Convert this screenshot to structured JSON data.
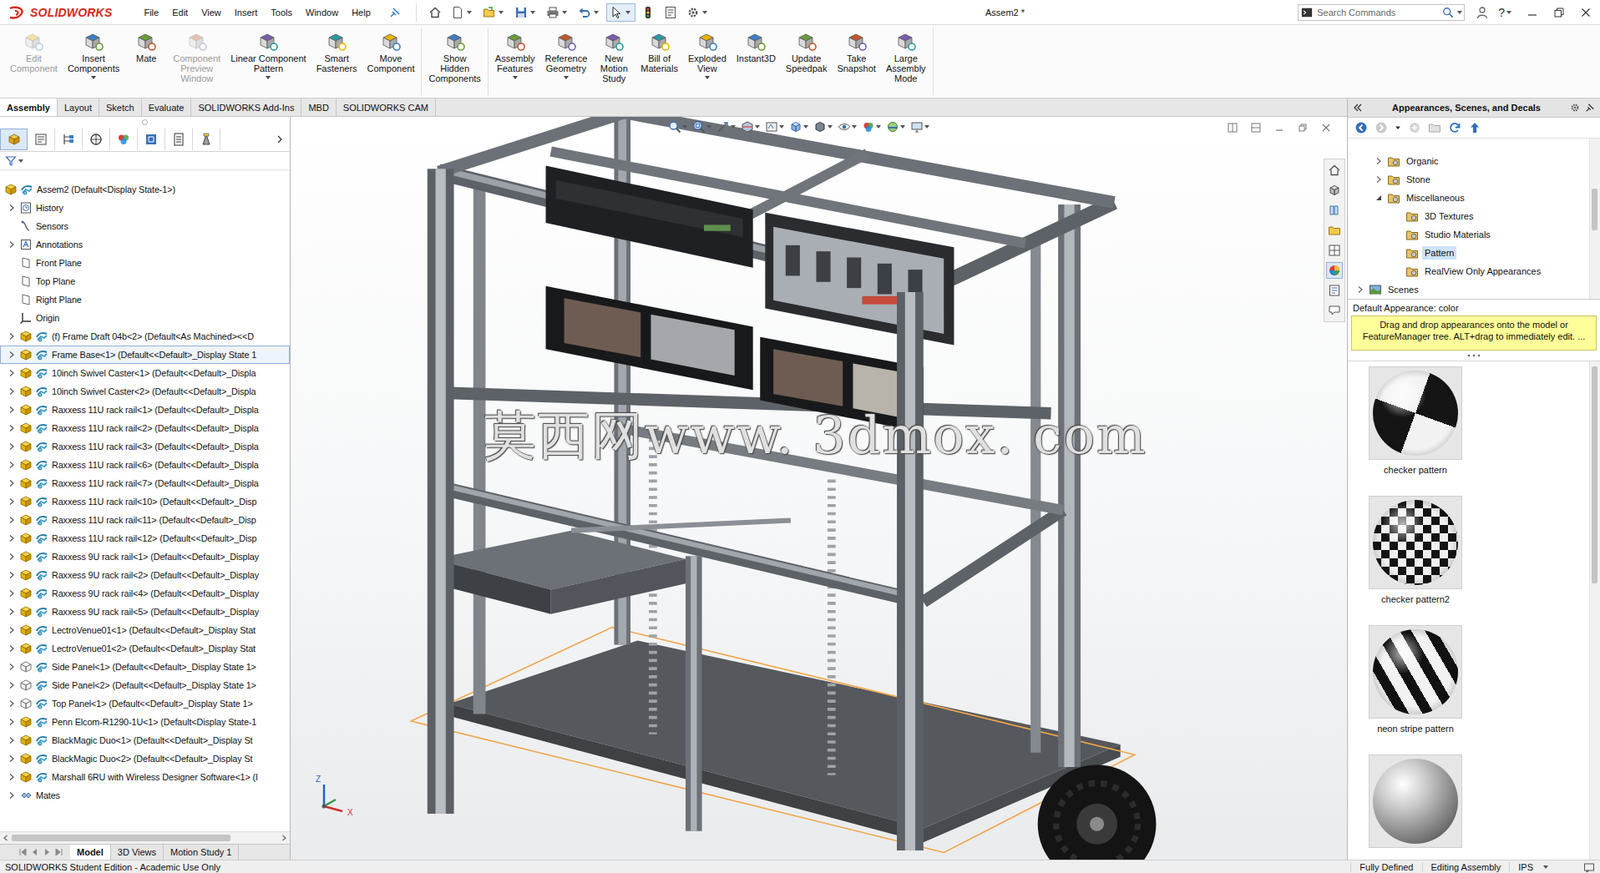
{
  "app": {
    "logo": "SOLIDWORKS",
    "title": "Assem2 *"
  },
  "menu": [
    "File",
    "Edit",
    "View",
    "Insert",
    "Tools",
    "Window",
    "Help"
  ],
  "toolbar": [
    {
      "selected": false
    },
    {
      "selected": false
    },
    {
      "selected": false
    },
    {
      "selected": false
    },
    {
      "selected": false
    },
    {
      "selected": false
    },
    {
      "selected": true
    },
    {
      "selected": false
    },
    {
      "selected": false
    },
    {
      "selected": false
    }
  ],
  "search": {
    "placeholder": "Search Commands"
  },
  "help": "?",
  "ribbon": {
    "groups": [
      [
        {
          "lines": [
            "Edit",
            "Component"
          ],
          "disabled": true,
          "dropdown": false
        },
        {
          "lines": [
            "Insert",
            "Components"
          ],
          "disabled": false,
          "dropdown": true
        },
        {
          "lines": [
            "Mate"
          ],
          "disabled": false,
          "dropdown": false
        },
        {
          "lines": [
            "Component",
            "Preview",
            "Window"
          ],
          "disabled": true,
          "dropdown": false
        },
        {
          "lines": [
            "Linear Component",
            "Pattern"
          ],
          "disabled": false,
          "dropdown": true
        },
        {
          "lines": [
            "Smart",
            "Fasteners"
          ],
          "disabled": false,
          "dropdown": false
        },
        {
          "lines": [
            "Move",
            "Component"
          ],
          "disabled": false,
          "dropdown": false
        }
      ],
      [
        {
          "lines": [
            "Show",
            "Hidden",
            "Components"
          ],
          "disabled": false,
          "dropdown": false
        }
      ],
      [
        {
          "lines": [
            "Assembly",
            "Features"
          ],
          "disabled": false,
          "dropdown": true
        },
        {
          "lines": [
            "Reference",
            "Geometry"
          ],
          "disabled": false,
          "dropdown": true
        },
        {
          "lines": [
            "New",
            "Motion",
            "Study"
          ],
          "disabled": false,
          "dropdown": false
        },
        {
          "lines": [
            "Bill of",
            "Materials"
          ],
          "disabled": false,
          "dropdown": false
        },
        {
          "lines": [
            "Exploded",
            "View"
          ],
          "disabled": false,
          "dropdown": true
        },
        {
          "lines": [
            "Instant3D"
          ],
          "disabled": false,
          "dropdown": false
        },
        {
          "lines": [
            "Update",
            "Speedpak"
          ],
          "disabled": false,
          "dropdown": false
        },
        {
          "lines": [
            "Take",
            "Snapshot"
          ],
          "disabled": false,
          "dropdown": false
        },
        {
          "lines": [
            "Large",
            "Assembly",
            "Mode"
          ],
          "disabled": false,
          "dropdown": false
        }
      ]
    ]
  },
  "command_tabs": [
    {
      "label": "Assembly",
      "selected": true
    },
    {
      "label": "Layout",
      "selected": false
    },
    {
      "label": "Sketch",
      "selected": false
    },
    {
      "label": "Evaluate",
      "selected": false
    },
    {
      "label": "SOLIDWORKS Add-Ins",
      "selected": false
    },
    {
      "label": "MBD",
      "selected": false
    },
    {
      "label": "SOLIDWORKS CAM",
      "selected": false
    }
  ],
  "feature_manager": {
    "tabs": [
      {
        "selected": true
      },
      {
        "selected": false
      },
      {
        "selected": false
      },
      {
        "selected": false
      },
      {
        "selected": false
      },
      {
        "selected": false
      },
      {
        "selected": false
      },
      {
        "selected": false
      }
    ],
    "tree": [
      {
        "label": "Assem2 (Default<Display State-1>)",
        "kind": "root",
        "depth": 0,
        "arrow": false,
        "selected": false
      },
      {
        "label": "History",
        "kind": "history",
        "depth": 1,
        "arrow": true,
        "selected": false
      },
      {
        "label": "Sensors",
        "kind": "sensors",
        "depth": 1,
        "arrow": false,
        "selected": false
      },
      {
        "label": "Annotations",
        "kind": "annotations",
        "depth": 1,
        "arrow": true,
        "selected": false
      },
      {
        "label": "Front Plane",
        "kind": "plane",
        "depth": 1,
        "arrow": false,
        "selected": false
      },
      {
        "label": "Top Plane",
        "kind": "plane",
        "depth": 1,
        "arrow": false,
        "selected": false
      },
      {
        "label": "Right Plane",
        "kind": "plane",
        "depth": 1,
        "arrow": false,
        "selected": false
      },
      {
        "label": "Origin",
        "kind": "origin",
        "depth": 1,
        "arrow": false,
        "selected": false
      },
      {
        "label": "(f) Frame Draft 04b<2> (Default<As Machined><<D",
        "kind": "assembly",
        "depth": 1,
        "arrow": true,
        "selected": false
      },
      {
        "label": "Frame Base<1> (Default<<Default>_Display State 1",
        "kind": "assembly",
        "depth": 1,
        "arrow": true,
        "selected": true
      },
      {
        "label": "10inch Swivel Caster<1> (Default<<Default>_Displa",
        "kind": "assembly",
        "depth": 1,
        "arrow": true,
        "selected": false
      },
      {
        "label": "10inch Swivel Caster<2> (Default<<Default>_Displa",
        "kind": "assembly",
        "depth": 1,
        "arrow": true,
        "selected": false
      },
      {
        "label": "Raxxess 11U rack rail<1> (Default<<Default>_Displa",
        "kind": "assembly",
        "depth": 1,
        "arrow": true,
        "selected": false
      },
      {
        "label": "Raxxess 11U rack rail<2> (Default<<Default>_Displa",
        "kind": "assembly",
        "depth": 1,
        "arrow": true,
        "selected": false
      },
      {
        "label": "Raxxess 11U rack rail<3> (Default<<Default>_Displa",
        "kind": "assembly",
        "depth": 1,
        "arrow": true,
        "selected": false
      },
      {
        "label": "Raxxess 11U rack rail<6> (Default<<Default>_Displa",
        "kind": "assembly",
        "depth": 1,
        "arrow": true,
        "selected": false
      },
      {
        "label": "Raxxess 11U rack rail<7> (Default<<Default>_Displa",
        "kind": "assembly",
        "depth": 1,
        "arrow": true,
        "selected": false
      },
      {
        "label": "Raxxess 11U rack rail<10> (Default<<Default>_Disp",
        "kind": "assembly",
        "depth": 1,
        "arrow": true,
        "selected": false
      },
      {
        "label": "Raxxess 11U rack rail<11> (Default<<Default>_Disp",
        "kind": "assembly",
        "depth": 1,
        "arrow": true,
        "selected": false
      },
      {
        "label": "Raxxess 11U rack rail<12> (Default<<Default>_Disp",
        "kind": "assembly",
        "depth": 1,
        "arrow": true,
        "selected": false
      },
      {
        "label": "Raxxess 9U rack rail<1> (Default<<Default>_Display",
        "kind": "assembly",
        "depth": 1,
        "arrow": true,
        "selected": false
      },
      {
        "label": "Raxxess 9U rack rail<2> (Default<<Default>_Display",
        "kind": "assembly",
        "depth": 1,
        "arrow": true,
        "selected": false
      },
      {
        "label": "Raxxess 9U rack rail<4> (Default<<Default>_Display",
        "kind": "assembly",
        "depth": 1,
        "arrow": true,
        "selected": false
      },
      {
        "label": "Raxxess 9U rack rail<5> (Default<<Default>_Display",
        "kind": "assembly",
        "depth": 1,
        "arrow": true,
        "selected": false
      },
      {
        "label": "LectroVenue01<1> (Default<<Default>_Display Stat",
        "kind": "assembly",
        "depth": 1,
        "arrow": true,
        "selected": false
      },
      {
        "label": "LectroVenue01<2> (Default<<Default>_Display Stat",
        "kind": "assembly",
        "depth": 1,
        "arrow": true,
        "selected": false
      },
      {
        "label": "Side Panel<1> (Default<<Default>_Display State 1>",
        "kind": "part",
        "depth": 1,
        "arrow": true,
        "selected": false
      },
      {
        "label": "Side Panel<2> (Default<<Default>_Display State 1>",
        "kind": "part",
        "depth": 1,
        "arrow": true,
        "selected": false
      },
      {
        "label": "Top Panel<1> (Default<<Default>_Display State 1>",
        "kind": "part",
        "depth": 1,
        "arrow": true,
        "selected": false
      },
      {
        "label": "Penn Elcom-R1290-1U<1> (Default<Display State-1",
        "kind": "assembly",
        "depth": 1,
        "arrow": true,
        "selected": false
      },
      {
        "label": "BlackMagic Duo<1> (Default<<Default>_Display St",
        "kind": "assembly",
        "depth": 1,
        "arrow": true,
        "selected": false
      },
      {
        "label": "BlackMagic Duo<2> (Default<<Default>_Display St",
        "kind": "assembly",
        "depth": 1,
        "arrow": true,
        "selected": false
      },
      {
        "label": "Marshall 6RU with Wireless Designer Software<1> (I",
        "kind": "assembly",
        "depth": 1,
        "arrow": true,
        "selected": false
      },
      {
        "label": "Mates",
        "kind": "mates",
        "depth": 1,
        "arrow": true,
        "selected": false
      }
    ],
    "bottom_tabs": [
      {
        "label": "Model",
        "selected": true
      },
      {
        "label": "3D Views",
        "selected": false
      },
      {
        "label": "Motion Study 1",
        "selected": false
      }
    ]
  },
  "viewport": {
    "watermark": "莫西网www. 3dmox. com",
    "triad": [
      "Z",
      "X"
    ]
  },
  "task_pane": {
    "title": "Appearances, Scenes, and Decals",
    "tree": [
      {
        "label": "Organic",
        "kind": "folder",
        "depth": 1,
        "expandable": true,
        "expanded": false,
        "selected": false
      },
      {
        "label": "Stone",
        "kind": "folder",
        "depth": 1,
        "expandable": true,
        "expanded": false,
        "selected": false
      },
      {
        "label": "Miscellaneous",
        "kind": "folder",
        "depth": 1,
        "expandable": true,
        "expanded": true,
        "selected": false
      },
      {
        "label": "3D Textures",
        "kind": "folder",
        "depth": 2,
        "expandable": false,
        "expanded": false,
        "selected": false
      },
      {
        "label": "Studio Materials",
        "kind": "folder",
        "depth": 2,
        "expandable": false,
        "expanded": false,
        "selected": false
      },
      {
        "label": "Pattern",
        "kind": "folder",
        "depth": 2,
        "expandable": false,
        "expanded": false,
        "selected": true
      },
      {
        "label": "RealView Only Appearances",
        "kind": "folder",
        "depth": 2,
        "expandable": false,
        "expanded": false,
        "selected": false
      },
      {
        "label": "Scenes",
        "kind": "scenes",
        "depth": 0,
        "expandable": true,
        "expanded": false,
        "selected": false
      }
    ],
    "default_appearance": "Default Appearance: color",
    "tip": "Drag and drop appearances onto the model or FeatureManager tree.  ALT+drag to immediately edit. ...",
    "swatches": [
      {
        "label": "checker pattern",
        "kind": "checker"
      },
      {
        "label": "checker pattern2",
        "kind": "checker2"
      },
      {
        "label": "neon stripe pattern",
        "kind": "stripe"
      },
      {
        "kind": "plain"
      }
    ]
  },
  "status_bar": {
    "text": "SOLIDWORKS Student Edition - Academic Use Only",
    "items": [
      "Fully Defined",
      "Editing Assembly",
      "IPS"
    ]
  }
}
